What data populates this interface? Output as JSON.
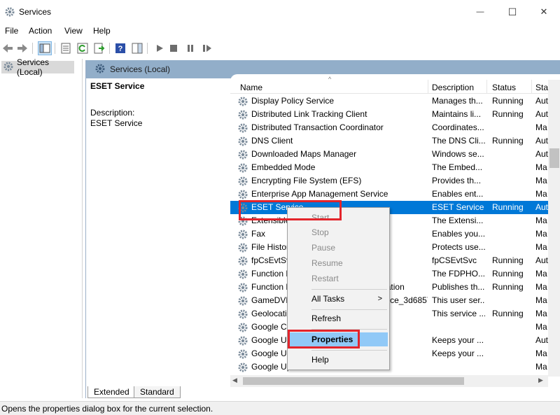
{
  "window": {
    "title": "Services",
    "minimize_glyph": "—",
    "maximize_glyph": "☐",
    "close_glyph": "✕"
  },
  "menu": [
    "File",
    "Action",
    "View",
    "Help"
  ],
  "toolbar": {
    "icons": [
      "back-icon",
      "forward-icon",
      "show-hide-console-tree-icon",
      "properties-icon",
      "refresh-icon",
      "export-list-icon",
      "help-icon",
      "action-pane-icon",
      "start-service-icon",
      "stop-service-icon",
      "pause-service-icon",
      "restart-service-icon"
    ]
  },
  "tree": {
    "label": "Services (Local)"
  },
  "panel": {
    "header": "Services (Local)",
    "selected_service": "ESET Service",
    "description_label": "Description:",
    "description_value": "ESET Service"
  },
  "columns": {
    "name": "Name",
    "description": "Description",
    "status": "Status",
    "startup": "Star"
  },
  "sort_glyph": "^",
  "services": [
    {
      "name": "Display Policy Service",
      "desc": "Manages th...",
      "status": "Running",
      "startup": "Aut"
    },
    {
      "name": "Distributed Link Tracking Client",
      "desc": "Maintains li...",
      "status": "Running",
      "startup": "Aut"
    },
    {
      "name": "Distributed Transaction Coordinator",
      "desc": "Coordinates...",
      "status": "",
      "startup": "Ma"
    },
    {
      "name": "DNS Client",
      "desc": "The DNS Cli...",
      "status": "Running",
      "startup": "Aut"
    },
    {
      "name": "Downloaded Maps Manager",
      "desc": "Windows se...",
      "status": "",
      "startup": "Aut"
    },
    {
      "name": "Embedded Mode",
      "desc": "The Embed...",
      "status": "",
      "startup": "Ma"
    },
    {
      "name": "Encrypting File System (EFS)",
      "desc": "Provides th...",
      "status": "",
      "startup": "Ma"
    },
    {
      "name": "Enterprise App Management Service",
      "desc": "Enables ent...",
      "status": "",
      "startup": "Ma"
    },
    {
      "name": "ESET Service",
      "desc": "ESET Service",
      "status": "Running",
      "startup": "Aut",
      "selected": true
    },
    {
      "name": "Extensible Authentication Protocol",
      "desc": "The Extensi...",
      "status": "",
      "startup": "Ma"
    },
    {
      "name": "Fax",
      "desc": "Enables you...",
      "status": "",
      "startup": "Ma"
    },
    {
      "name": "File History Service",
      "desc": "Protects use...",
      "status": "",
      "startup": "Ma"
    },
    {
      "name": "fpCsEvtSvc",
      "desc": "fpCSEvtSvc",
      "status": "Running",
      "startup": "Aut"
    },
    {
      "name": "Function Discovery Provider Host",
      "desc": "The FDPHO...",
      "status": "Running",
      "startup": "Ma"
    },
    {
      "name": "Function Discovery Resource Publication",
      "desc": "Publishes th...",
      "status": "Running",
      "startup": "Ma"
    },
    {
      "name": "GameDVR and Broadcast User Service_3d68573",
      "desc": "This user ser...",
      "status": "",
      "startup": "Ma"
    },
    {
      "name": "Geolocation Service",
      "desc": "This service ...",
      "status": "Running",
      "startup": "Ma"
    },
    {
      "name": "Google Chrome Elevation Service",
      "desc": "",
      "status": "",
      "startup": "Ma"
    },
    {
      "name": "Google Update Service (gupdate)",
      "desc": "Keeps your ...",
      "status": "",
      "startup": "Aut"
    },
    {
      "name": "Google Update Service (gupdatem)",
      "desc": "Keeps your ...",
      "status": "",
      "startup": "Ma"
    },
    {
      "name": "Google Updater Service",
      "desc": "",
      "status": "",
      "startup": "Ma"
    }
  ],
  "context_menu": {
    "start": "Start",
    "stop": "Stop",
    "pause": "Pause",
    "resume": "Resume",
    "restart": "Restart",
    "all_tasks": "All Tasks",
    "all_tasks_arrow": ">",
    "refresh": "Refresh",
    "properties": "Properties",
    "help": "Help"
  },
  "tabs": [
    "Extended",
    "Standard"
  ],
  "scroll_glyphs": {
    "left": "◀",
    "right": "▶"
  },
  "status_bar": "Opens the properties dialog box for the current selection.",
  "colors": {
    "selection": "#0078d7",
    "menu_highlight": "#91c9f7",
    "callout_box": "#e3242b",
    "panel_header": "#92aec9"
  }
}
